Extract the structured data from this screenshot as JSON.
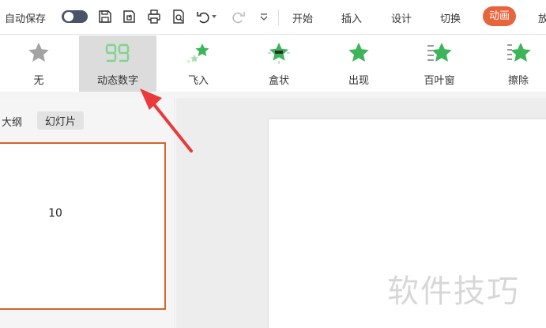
{
  "quick_access": {
    "autosave_label": "自动保存",
    "icons": [
      "save-icon",
      "save-as-icon",
      "print-icon",
      "print-preview-icon",
      "undo-icon",
      "redo-icon",
      "customize-toolbar-icon"
    ]
  },
  "menu_tabs": {
    "start": "开始",
    "insert": "插入",
    "design": "设计",
    "transition": "切换",
    "animation": "动画",
    "partial": "放"
  },
  "animations": {
    "none": "无",
    "dynamic_number": "动态数字",
    "fly_in": "飞入",
    "box": "盒状",
    "appear": "出现",
    "blinds": "百叶窗",
    "wipe": "擦除"
  },
  "left_pane": {
    "outline_tab": "大纲",
    "slides_tab": "幻灯片",
    "slide_number": "10"
  },
  "watermark": "软件技巧",
  "colors": {
    "accent": "#e8643c",
    "anim_green": "#3cb45a",
    "selection_border": "#d2642e",
    "arrow": "#e83a3a"
  }
}
